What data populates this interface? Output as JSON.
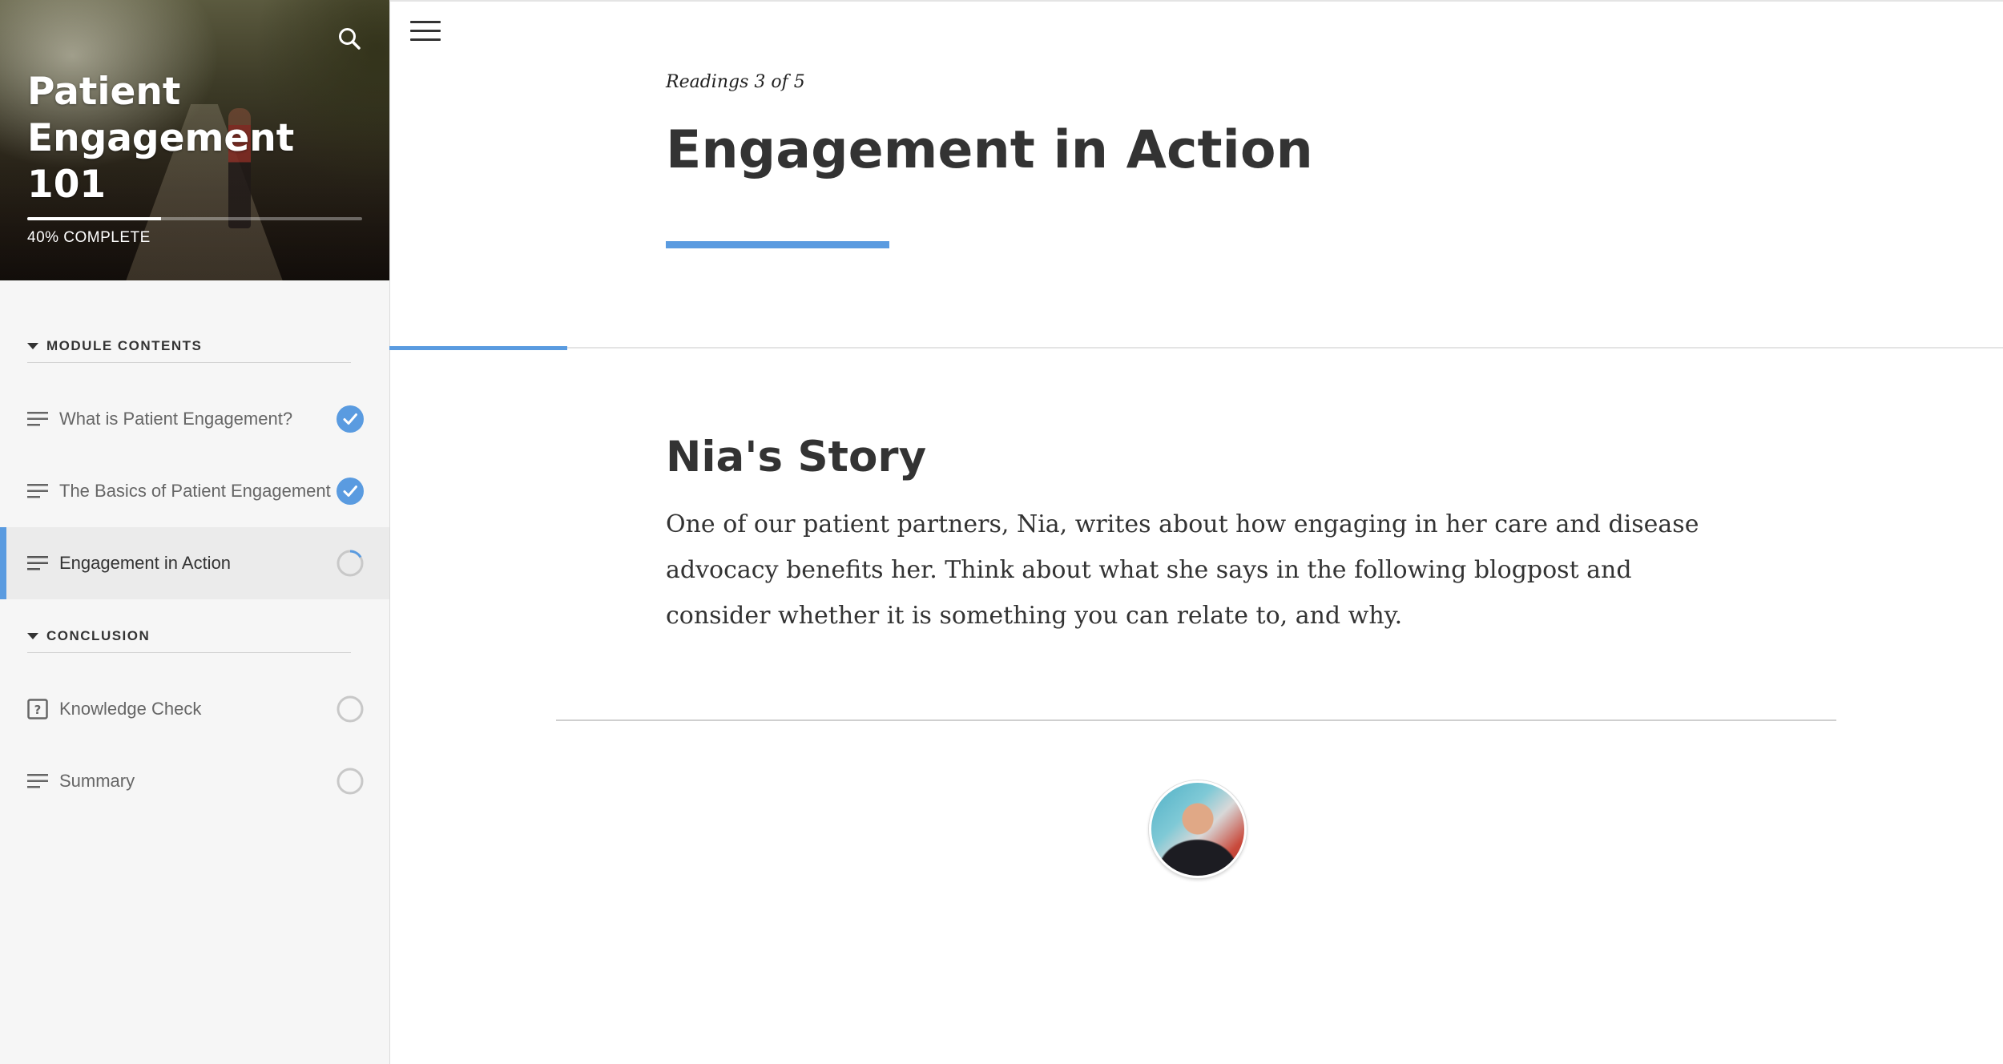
{
  "sidebar": {
    "course_title": "Patient Engagement 101",
    "progress_percent": 40,
    "progress_label": "40% COMPLETE",
    "sections": [
      {
        "title": "MODULE CONTENTS",
        "items": [
          {
            "label": "What is Patient Engagement?",
            "icon": "text-lines-icon",
            "status": "complete"
          },
          {
            "label": "The Basics of Patient Engagement",
            "icon": "text-lines-icon",
            "status": "complete"
          },
          {
            "label": "Engagement in Action",
            "icon": "text-lines-icon",
            "status": "in-progress",
            "active": true
          }
        ]
      },
      {
        "title": "CONCLUSION",
        "items": [
          {
            "label": "Knowledge Check",
            "icon": "quiz-icon",
            "status": "not-started"
          },
          {
            "label": "Summary",
            "icon": "text-lines-icon",
            "status": "not-started"
          }
        ]
      }
    ]
  },
  "lesson": {
    "counter": "Readings 3 of 5",
    "title": "Engagement in Action",
    "story_heading": "Nia's Story",
    "story_body": "One of our patient partners, Nia, writes about how engaging in her care and disease advocacy benefits her. Think about what she says in the following blogpost and consider whether it is something you can relate to, and why."
  },
  "colors": {
    "accent": "#5a9be0",
    "text": "#333333",
    "sidebar_bg": "#f6f6f6"
  },
  "icons": {
    "search": "search-icon",
    "menu": "hamburger-menu-icon"
  }
}
